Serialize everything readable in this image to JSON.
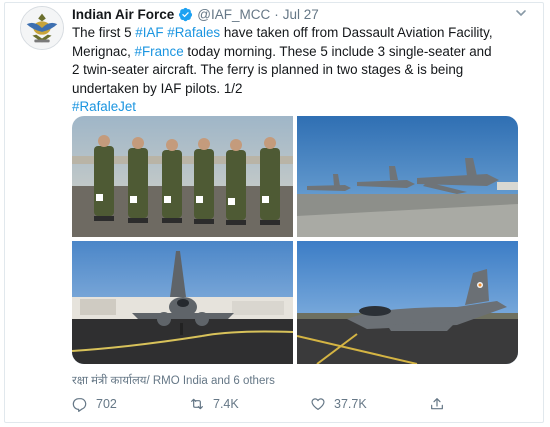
{
  "tweet": {
    "author_name": "Indian Air Force",
    "handle": "@IAF_MCC",
    "separator": "·",
    "date": "Jul 27",
    "lines": [
      [
        {
          "t": "The first 5 ",
          "tag": false
        },
        {
          "t": "#IAF",
          "tag": true
        },
        {
          "t": " ",
          "tag": false
        },
        {
          "t": "#Rafales",
          "tag": true
        },
        {
          "t": " have taken off from Dassault Aviation Facility,",
          "tag": false
        }
      ],
      [
        {
          "t": "Merignac, ",
          "tag": false
        },
        {
          "t": "#France",
          "tag": true
        },
        {
          "t": " today morning. These 5 include 3 single-seater and",
          "tag": false
        }
      ],
      [
        {
          "t": "2 twin-seater aircraft. The ferry is planned in two stages & is being",
          "tag": false
        }
      ],
      [
        {
          "t": "undertaken by IAF pilots. 1/2",
          "tag": false
        }
      ],
      [
        {
          "t": "#RafaleJet",
          "tag": true
        }
      ]
    ],
    "tagged_users": "रक्षा मंत्री कार्यालय/ RMO India and 6 others",
    "stats": {
      "replies": "702",
      "retweets": "7.4K",
      "likes": "37.7K"
    }
  },
  "icons": {
    "avatar": "iaf-emblem-icon",
    "verified": "verified-badge-icon",
    "more": "chevron-down-icon",
    "reply": "reply-icon",
    "retweet": "retweet-icon",
    "like": "heart-icon",
    "share": "share-icon"
  },
  "colors": {
    "link": "#1b95e0",
    "text": "#14171a",
    "secondary": "#657786",
    "verified": "#1da1f2"
  }
}
